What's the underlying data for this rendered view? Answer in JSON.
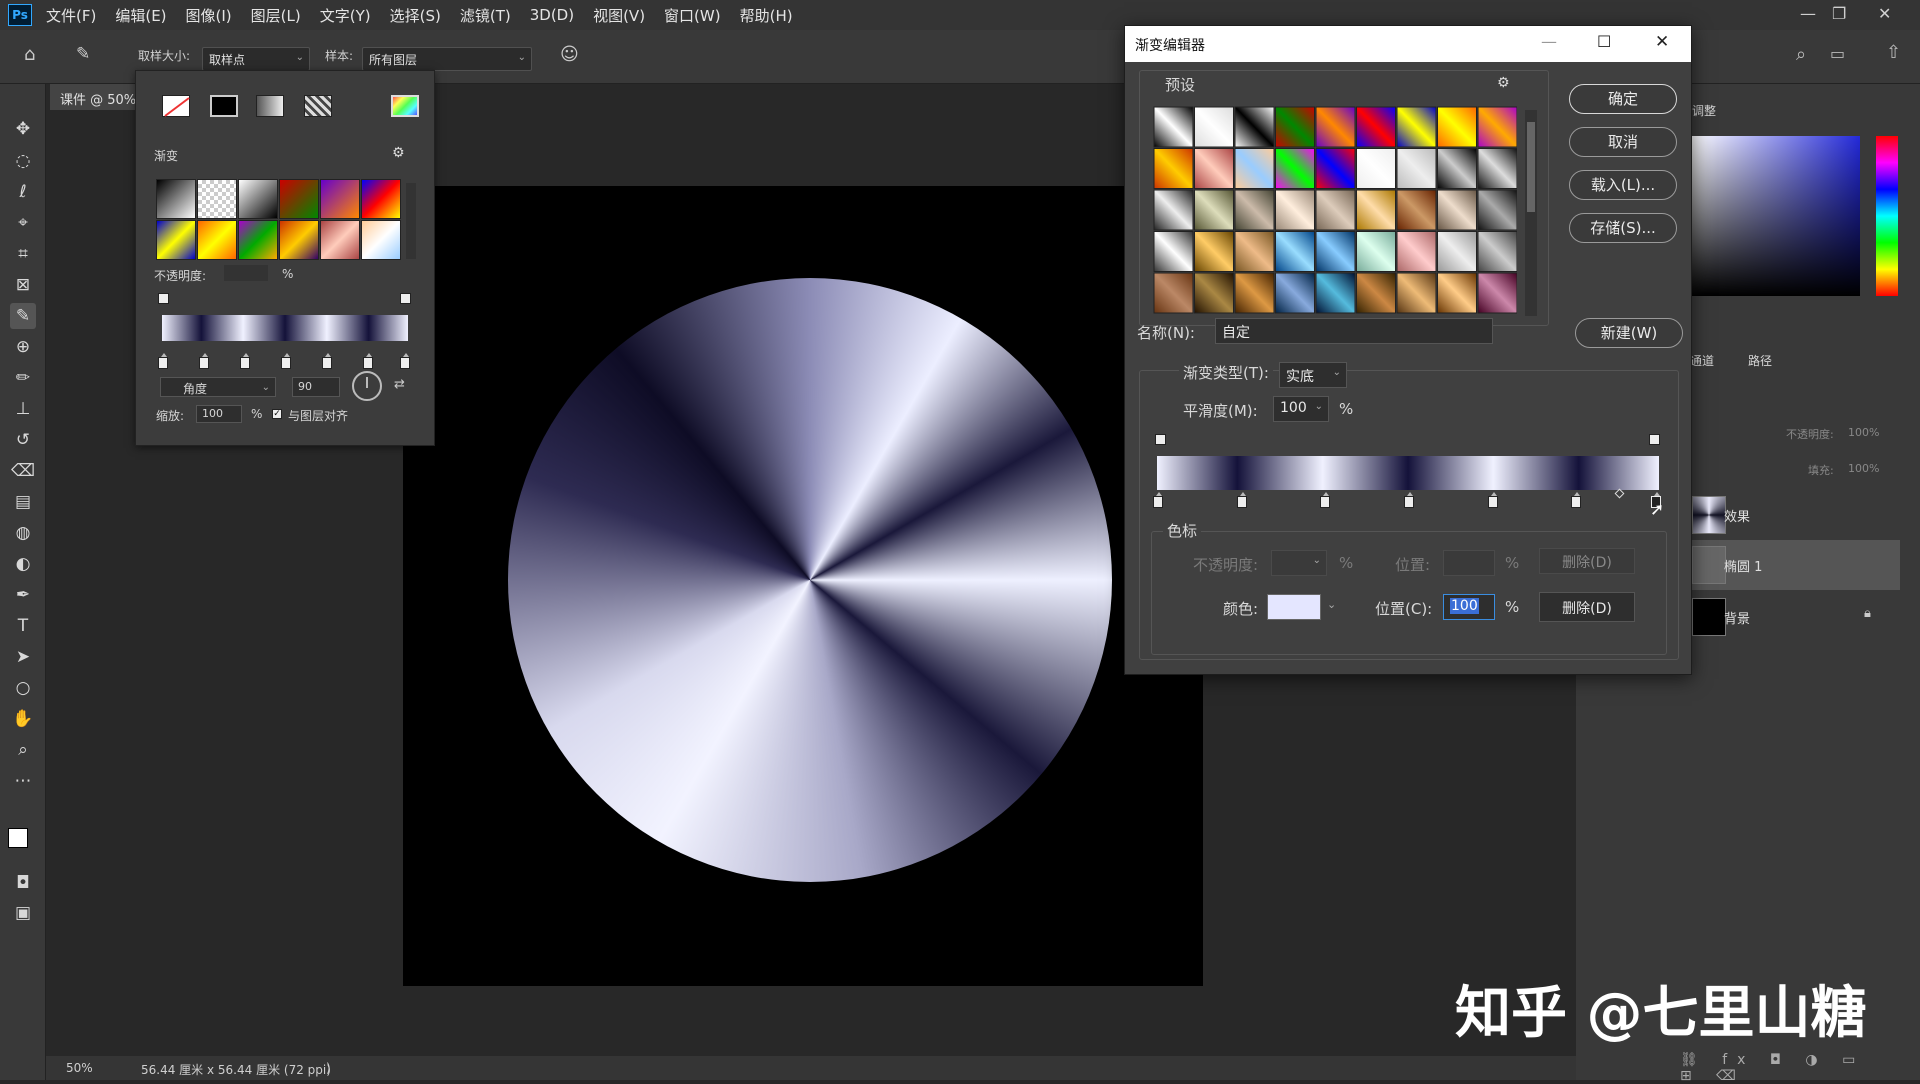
{
  "menubar": {
    "logo": "Ps",
    "items": [
      "文件(F)",
      "编辑(E)",
      "图像(I)",
      "图层(L)",
      "文字(Y)",
      "选择(S)",
      "滤镜(T)",
      "3D(D)",
      "视图(V)",
      "窗口(W)",
      "帮助(H)"
    ]
  },
  "options": {
    "sample_size_label": "取样大小:",
    "sample_size_value": "取样点",
    "sample_label": "样本:",
    "sample_value": "所有图层"
  },
  "document": {
    "tab_title": "课件 @ 50%",
    "zoom": "50%",
    "dimensions": "56.44 厘米 x 56.44 厘米 (72 ppi)",
    "arrow": ")"
  },
  "gradient_picker": {
    "section_label": "渐变",
    "opacity_label": "不透明度:",
    "opacity_unit": "%",
    "style_value": "角度",
    "angle_value": "90",
    "scale_label": "缩放:",
    "scale_value": "100",
    "scale_unit": "%",
    "align_label": "与图层对齐"
  },
  "dialog": {
    "title": "渐变编辑器",
    "presets_label": "预设",
    "ok_label": "确定",
    "cancel_label": "取消",
    "load_label": "载入(L)...",
    "save_label": "存储(S)...",
    "name_label": "名称(N):",
    "name_value": "自定",
    "new_label": "新建(W)",
    "type_label": "渐变类型(T):",
    "type_value": "实底",
    "smooth_label": "平滑度(M):",
    "smooth_value": "100",
    "smooth_unit": "%",
    "stops_group_label": "色标",
    "opacity_label": "不透明度:",
    "opacity_unit": "%",
    "opacity_pos_label": "位置:",
    "opacity_pos_unit": "%",
    "delete_label_1": "删除(D)",
    "color_label": "颜色:",
    "color_pos_label": "位置(C):",
    "color_pos_value": "100",
    "color_pos_unit": "%",
    "delete_label_2": "删除(D)",
    "selected_color": "#e4e6ff"
  },
  "panels": {
    "adjust_tab": "调整",
    "channels_tab": "通道",
    "paths_tab": "路径",
    "opacity_label": "不透明度:",
    "opacity_value": "100%",
    "fill_label": "填充:",
    "fill_value": "100%",
    "layers": [
      {
        "name": "效果"
      },
      {
        "name": "椭圆 1"
      },
      {
        "name": "背景"
      }
    ]
  },
  "watermark": "知乎 @七里山糖",
  "colors": {
    "accent_blue": "#31a8ff",
    "gradient_dark": "#0e0c25",
    "gradient_light": "#eceeff"
  }
}
